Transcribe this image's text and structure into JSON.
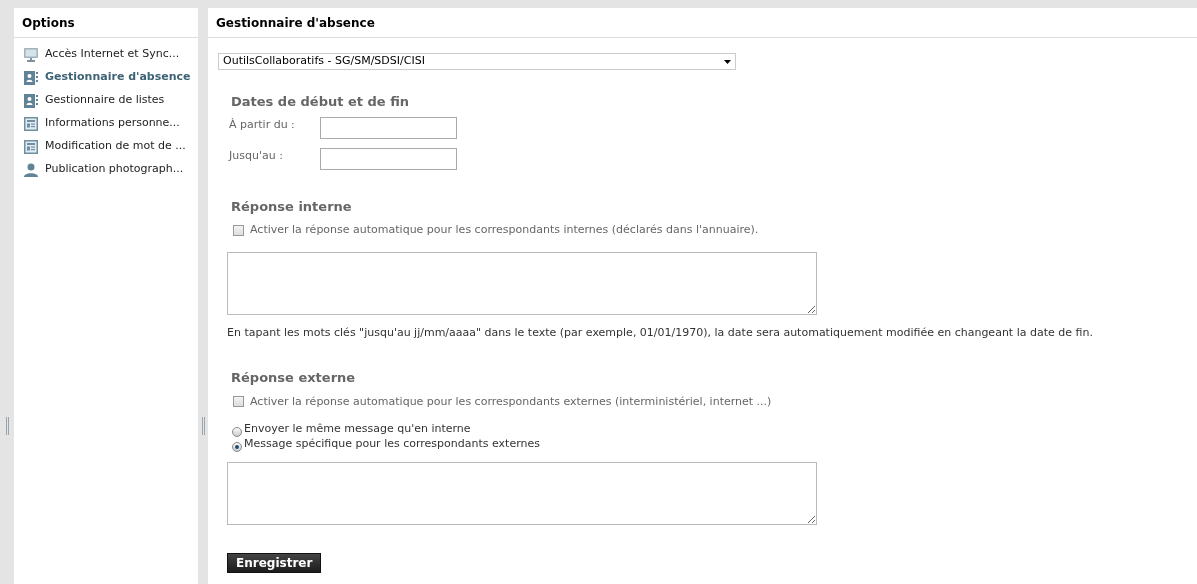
{
  "sidebar": {
    "title": "Options",
    "items": [
      {
        "label": "Accès Internet et Sync...",
        "kind": "monitor",
        "selected": false
      },
      {
        "label": "Gestionnaire d'absence",
        "kind": "card",
        "selected": true
      },
      {
        "label": "Gestionnaire de listes",
        "kind": "card",
        "selected": false
      },
      {
        "label": "Informations personne...",
        "kind": "document",
        "selected": false
      },
      {
        "label": "Modification de mot de ...",
        "kind": "document",
        "selected": false
      },
      {
        "label": "Publication photograph...",
        "kind": "person",
        "selected": false
      }
    ]
  },
  "main": {
    "title": "Gestionnaire d'absence",
    "account_select": {
      "value": "OutilsCollaboratifs - SG/SM/SDSI/CISI"
    },
    "dates": {
      "heading": "Dates de début et de fin",
      "from_label": "À partir du :",
      "to_label": "Jusqu'au :"
    },
    "internal": {
      "heading": "Réponse interne",
      "checkbox": {
        "label": "Activer la réponse automatique pour les correspondants internes (déclarés dans l'annuaire).",
        "checked": false
      },
      "note": "En tapant les mots clés \"jusqu'au jj/mm/aaaa\" dans le texte (par exemple, 01/01/1970), la date sera automatiquement modifiée en changeant la date de fin."
    },
    "external": {
      "heading": "Réponse externe",
      "checkbox": {
        "label": "Activer la réponse automatique pour les correspondants externes (interministériel, internet ...)",
        "checked": false
      },
      "options": [
        {
          "label": "Envoyer le même message qu'en interne",
          "selected": false
        },
        {
          "label": "Message spécifique pour les correspondants externes",
          "selected": true
        }
      ]
    },
    "save_button": "Enregistrer"
  }
}
